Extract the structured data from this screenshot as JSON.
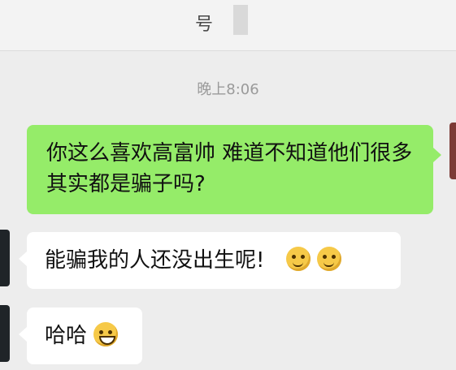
{
  "header": {
    "title": "号"
  },
  "chat": {
    "timestamp": "晚上8:06",
    "messages": [
      {
        "side": "sent",
        "text": "你这么喜欢高富帅 难道不知道他们很多其实都是骗子吗?"
      },
      {
        "side": "received",
        "text": "能骗我的人还没出生呢!",
        "emojis": [
          "smirk-emoji",
          "smirk-emoji"
        ]
      },
      {
        "side": "received",
        "text": "哈哈",
        "emojis": [
          "grin-emoji"
        ]
      }
    ]
  },
  "colors": {
    "sent_bubble": "#95ec69",
    "received_bubble": "#ffffff",
    "background": "#ededed"
  }
}
